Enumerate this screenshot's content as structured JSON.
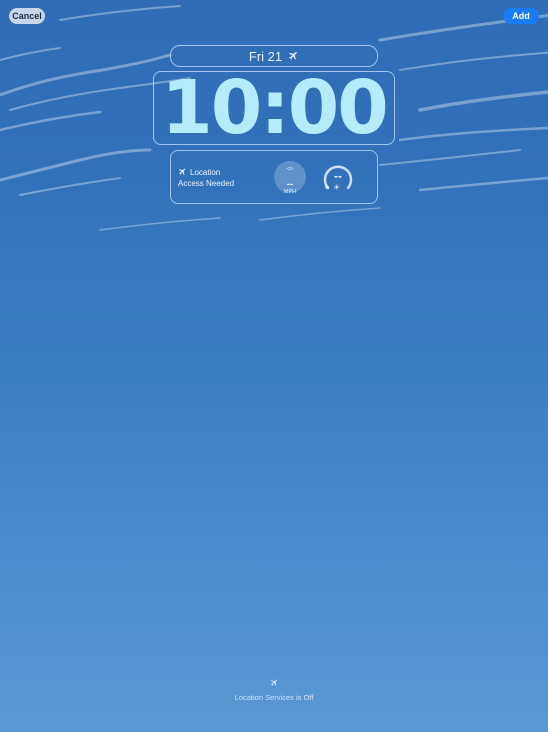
{
  "header": {
    "cancel_label": "Cancel",
    "add_label": "Add"
  },
  "lock_screen": {
    "date_text": "Fri 21",
    "date_icon": "airplane-icon",
    "time": "10:00"
  },
  "widgets": {
    "location": {
      "icon": "location-arrow-icon",
      "line1": "Location",
      "line2": "Access Needed"
    },
    "speed": {
      "value": "--",
      "unit": "MPH"
    },
    "uv": {
      "value": "--",
      "icon": "sun-icon"
    }
  },
  "footer": {
    "icon": "location-arrow-icon",
    "text": "Location Services is Off"
  },
  "colors": {
    "add_button": "#1a7cf5",
    "time_text": "#b4ecfb"
  }
}
